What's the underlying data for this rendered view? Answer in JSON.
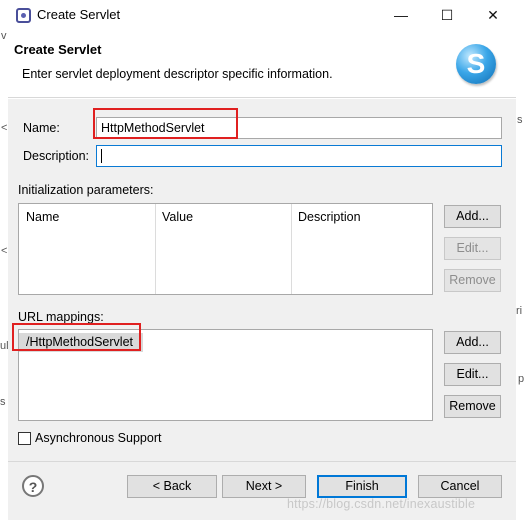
{
  "window": {
    "title": "Create Servlet",
    "min_glyph": "—",
    "max_glyph": "☐",
    "close_glyph": "✕"
  },
  "header": {
    "title": "Create Servlet",
    "description": "Enter servlet deployment descriptor specific information.",
    "logo_letter": "S"
  },
  "form": {
    "name_label": "Name:",
    "name_value": "HttpMethodServlet",
    "description_label": "Description:",
    "description_value": ""
  },
  "init_params": {
    "label": "Initialization parameters:",
    "columns": [
      "Name",
      "Value",
      "Description"
    ],
    "rows": [],
    "add_label": "Add...",
    "edit_label": "Edit...",
    "remove_label": "Remove"
  },
  "url_mappings": {
    "label": "URL mappings:",
    "items": [
      "/HttpMethodServlet"
    ],
    "add_label": "Add...",
    "edit_label": "Edit...",
    "remove_label": "Remove"
  },
  "options": {
    "async_label": "Asynchronous Support",
    "async_checked": false
  },
  "footer": {
    "help_glyph": "?",
    "back_label": "< Back",
    "next_label": "Next >",
    "finish_label": "Finish",
    "cancel_label": "Cancel"
  },
  "watermark": "https://blog.csdn.net/inexaustible",
  "background_slivers": {
    "right": [
      "s",
      "ri",
      "p"
    ],
    "left": [
      "v",
      "<",
      "<",
      "ul",
      "s"
    ]
  },
  "colors": {
    "highlight_box": "#e02020",
    "focus_border": "#0a7ad4",
    "default_button_border": "#0078d7",
    "dialog_bg": "#f0f0f0"
  }
}
